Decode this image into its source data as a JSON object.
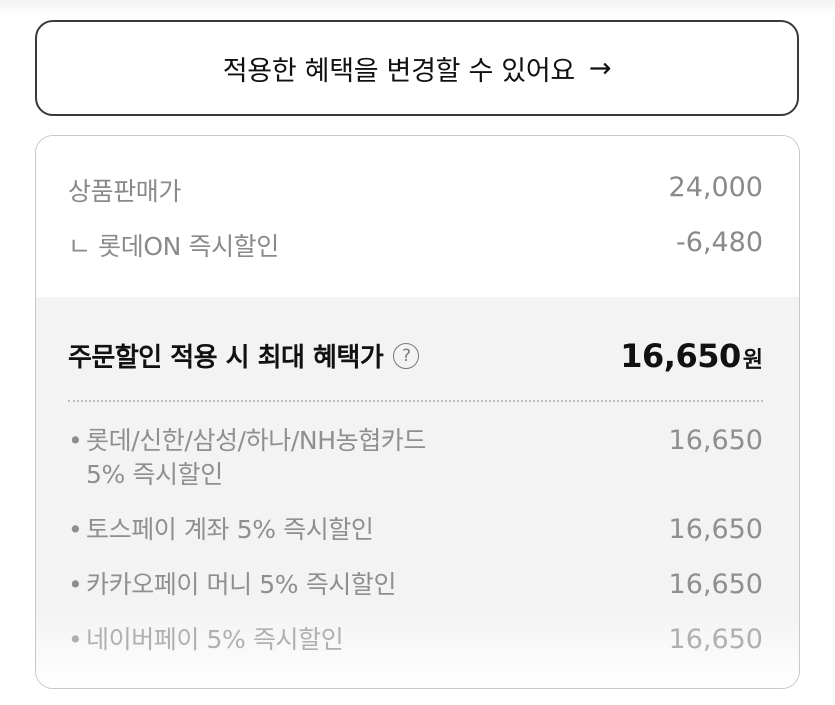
{
  "change_benefit_button": {
    "label": "적용한 혜택을 변경할 수 있어요",
    "arrow": "→"
  },
  "summary": {
    "product_price_label": "상품판매가",
    "product_price_value": "24,000",
    "lotte_on_discount_label": "ㄴ 롯데ON 즉시할인",
    "lotte_on_discount_value": "-6,480"
  },
  "max_benefit": {
    "label": "주문할인 적용 시 최대 혜택가",
    "help_icon": "question-circle-icon",
    "help_glyph": "?",
    "price": "16,650",
    "unit": "원"
  },
  "benefits": [
    {
      "bullet": "•",
      "label_line1": "롯데/신한/삼성/하나/NH농협카드",
      "label_line2": "5% 즉시할인",
      "value": "16,650"
    },
    {
      "bullet": "•",
      "label_line1": "토스페이 계좌 5% 즉시할인",
      "value": "16,650"
    },
    {
      "bullet": "•",
      "label_line1": "카카오페이 머니 5% 즉시할인",
      "value": "16,650"
    },
    {
      "bullet": "•",
      "label_line1": "네이버페이 5% 즉시할인",
      "value": "16,650"
    }
  ]
}
